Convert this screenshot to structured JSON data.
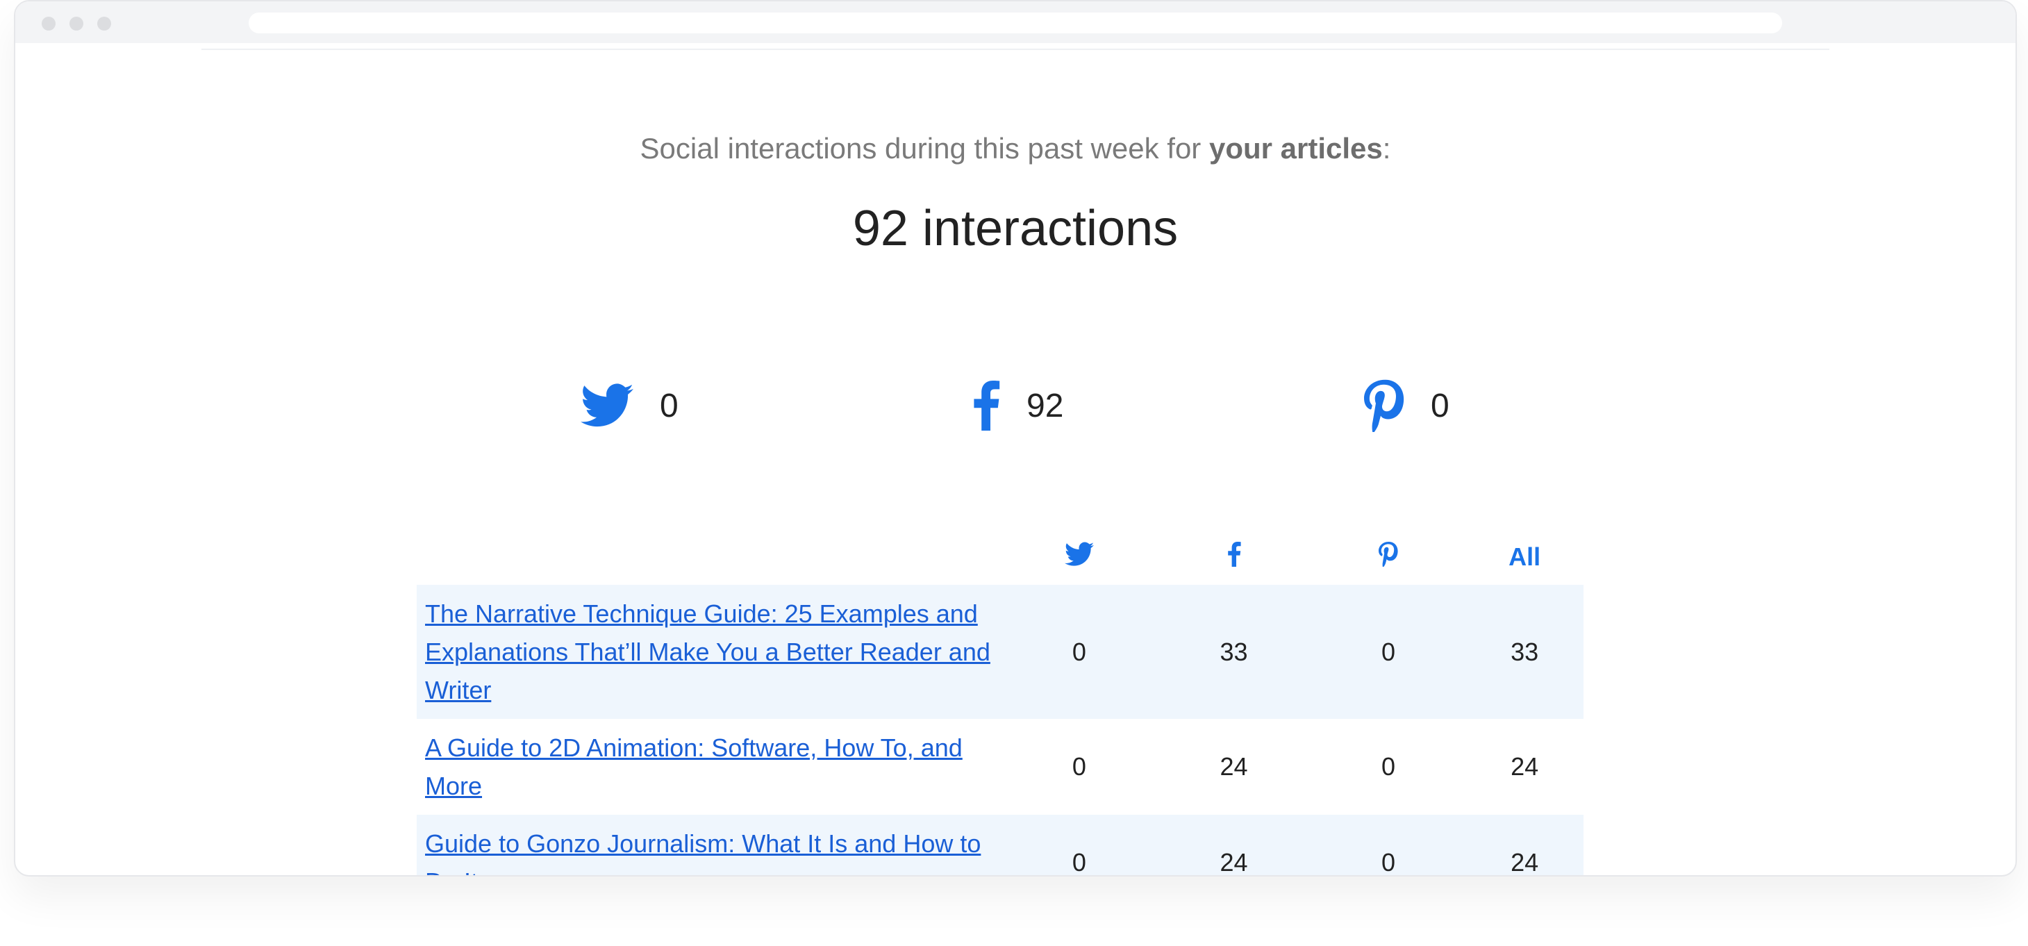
{
  "email": {
    "intro_prefix": "Social interactions during this past week for ",
    "intro_bold": "your articles",
    "intro_suffix": ":",
    "total": "92 interactions"
  },
  "summary": {
    "twitter": "0",
    "facebook": "92",
    "pinterest": "0"
  },
  "table": {
    "header_all": "All",
    "rows": [
      {
        "title": "The Narrative Technique Guide: 25 Examples and Explanations That’ll Make You a Better Reader and Writer",
        "twitter": "0",
        "facebook": "33",
        "pinterest": "0",
        "all": "33"
      },
      {
        "title": "A Guide to 2D Animation: Software, How To, and More",
        "twitter": "0",
        "facebook": "24",
        "pinterest": "0",
        "all": "24"
      },
      {
        "title": "Guide to Gonzo Journalism: What It Is and How to Do It",
        "twitter": "0",
        "facebook": "24",
        "pinterest": "0",
        "all": "24"
      }
    ]
  },
  "colors": {
    "accent": "#1a73e8",
    "link": "#1a5fd6",
    "row_shade": "#eff6fd"
  },
  "icons": {
    "twitter": "twitter-icon",
    "facebook": "facebook-icon",
    "pinterest": "pinterest-icon"
  }
}
